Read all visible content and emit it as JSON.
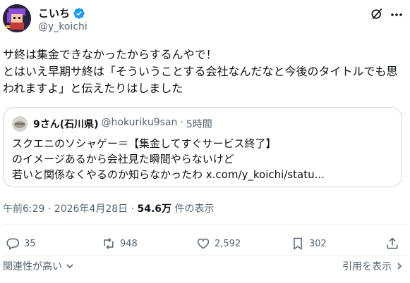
{
  "author": {
    "name": "こいち",
    "handle": "@y_koichi"
  },
  "tweet": {
    "text": "サ終は集金できなかったからするんやで！\nとはいえ早期サ終は「そういうことする会社なんだなと今後のタイトルでも思われますよ」と伝えたりはしました"
  },
  "quote": {
    "name": "9さん(石川県)",
    "handle": "@hokuriku9san",
    "separator": "·",
    "time": "5時間",
    "text": "スクエニのソシャゲー＝【集金してすぐサービス終了】\nのイメージあるから会社見た瞬間やらないけど\n若いと関係なくやるのか知らなかったわ x.com/y_koichi/statu..."
  },
  "meta": {
    "timestamp": "午前6:29 · 2026年4月28日 ·",
    "views_count": "54.6万",
    "views_label": "件の表示"
  },
  "actions": {
    "reply_count": "35",
    "repost_count": "948",
    "like_count": "2,592",
    "bookmark_count": "302"
  },
  "footer": {
    "sort_label": "関連性が高い",
    "quotes_label": "引用を表示"
  },
  "colors": {
    "text": "#0f1419",
    "muted": "#536471",
    "verified": "#1d9bf0",
    "border": "#cfd9de"
  }
}
